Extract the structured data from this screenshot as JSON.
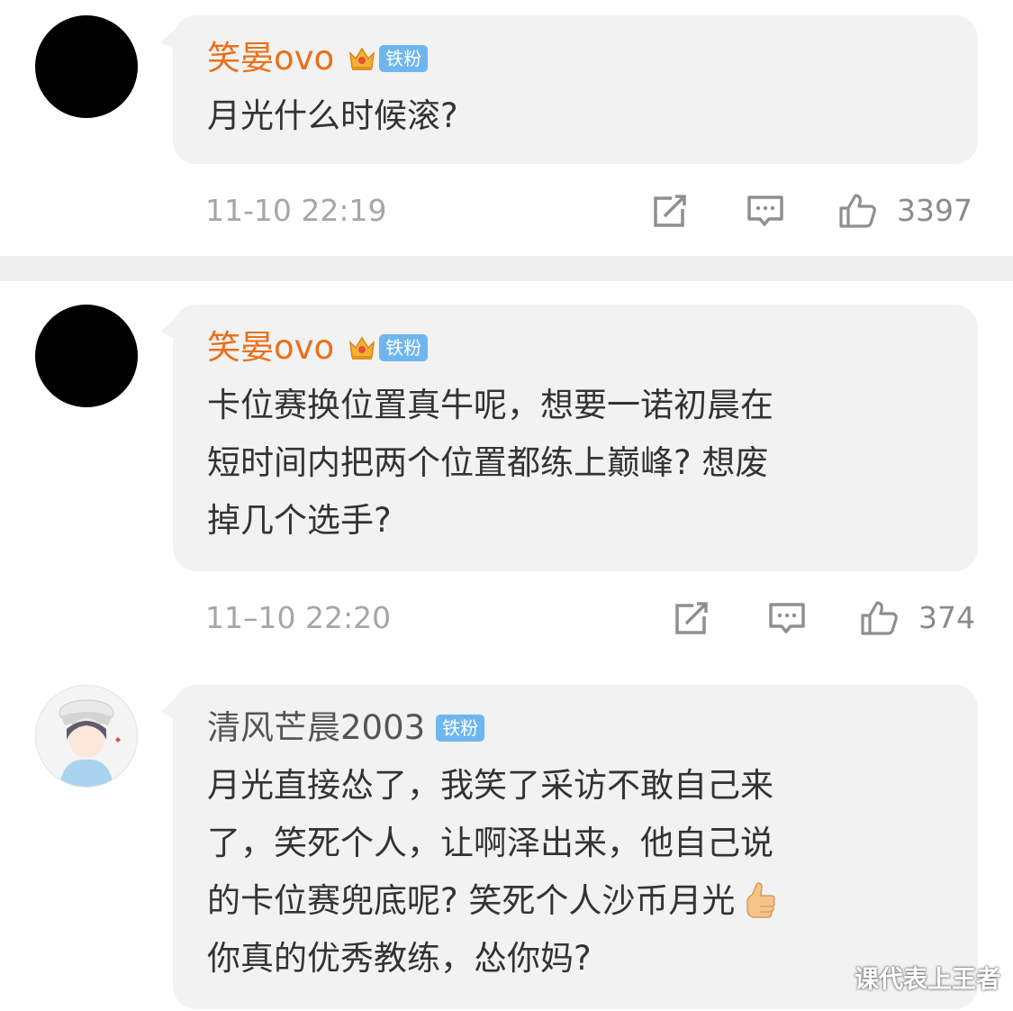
{
  "comments": [
    {
      "user": "笑晏ovo",
      "badge": "铁粉",
      "lines": [
        "月光什么时候滚?"
      ],
      "time": "11-10 22:19",
      "likes": "3397"
    },
    {
      "user": "笑晏ovo",
      "badge": "铁粉",
      "lines": [
        "卡位赛换位置真牛呢，想要一诺初晨在",
        "短时间内把两个位置都练上巅峰? 想废",
        "掉几个选手?"
      ],
      "time": "11–10 22:20",
      "likes": "374"
    },
    {
      "user": "清风芒晨2003",
      "badge": "铁粉",
      "lines": [
        "月光直接怂了，我笑了采访不敢自己来",
        "了，笑死个人，让啊泽出来，他自己说",
        "的卡位赛兜底呢? 笑死个人沙币月光",
        "你真的优秀教练，怂你妈?"
      ]
    }
  ],
  "watermark": "课代表上王者",
  "colors": {
    "username": "#ea6f1a",
    "badge": "#6fb6ee",
    "bubble": "#f2f2f2",
    "divider": "#efefef"
  },
  "icons": [
    "avatar",
    "crown-icon",
    "repost-icon",
    "comment-icon",
    "like-icon",
    "thumbs-up-emoji"
  ]
}
